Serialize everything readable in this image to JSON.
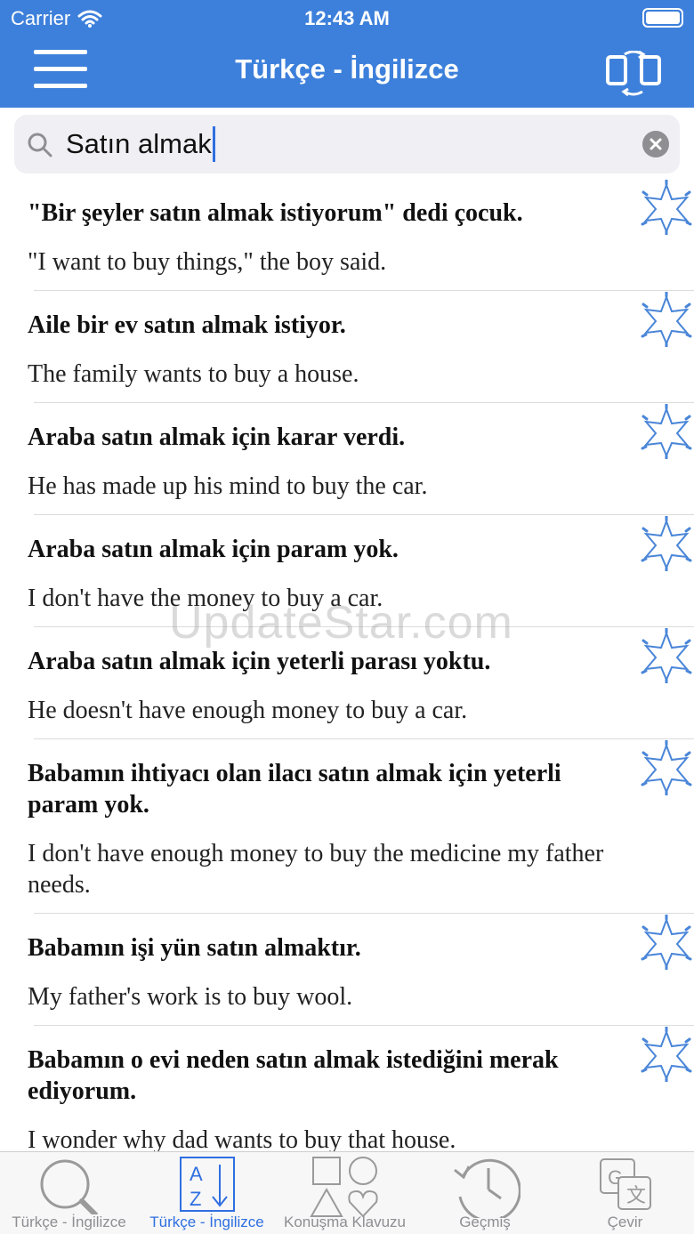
{
  "status": {
    "carrier": "Carrier",
    "time": "12:43 AM"
  },
  "nav": {
    "title": "Türkçe - İngilizce"
  },
  "search": {
    "value": "Satın almak"
  },
  "results": [
    {
      "tr": "\"Bir şeyler satın almak istiyorum\" dedi çocuk.",
      "en": "\"I want to buy things,\" the boy said."
    },
    {
      "tr": "Aile bir ev satın almak istiyor.",
      "en": "The family wants to buy a house."
    },
    {
      "tr": "Araba satın almak için karar verdi.",
      "en": "He has made up his mind to buy the car."
    },
    {
      "tr": "Araba satın almak için param yok.",
      "en": "I don't have the money to buy a car."
    },
    {
      "tr": "Araba satın almak için yeterli parası yoktu.",
      "en": "He doesn't have enough money to buy a car."
    },
    {
      "tr": "Babamın ihtiyacı olan ilacı satın almak için yeterli param yok.",
      "en": "I don't have enough money to buy the medicine my father needs."
    },
    {
      "tr": "Babamın işi yün satın almaktır.",
      "en": "My father's work is to buy wool."
    },
    {
      "tr": "Babamın o evi neden satın almak istediğini merak ediyorum.",
      "en": "I wonder why dad wants to buy that house."
    }
  ],
  "watermark": "UpdateStar.com",
  "tabs": [
    {
      "label": "Türkçe - İngilizce",
      "icon": "magnifier-icon"
    },
    {
      "label": "Türkçe - İngilizce",
      "icon": "az-sort-icon"
    },
    {
      "label": "Konuşma Klavuzu",
      "icon": "shapes-icon"
    },
    {
      "label": "Geçmiş",
      "icon": "history-clock-icon"
    },
    {
      "label": "Çevir",
      "icon": "translate-icon"
    }
  ],
  "colors": {
    "accent": "#3d80db",
    "active_tab": "#2f6fe0",
    "inactive_tab": "#8e8e93",
    "star": "#4a86d8"
  }
}
